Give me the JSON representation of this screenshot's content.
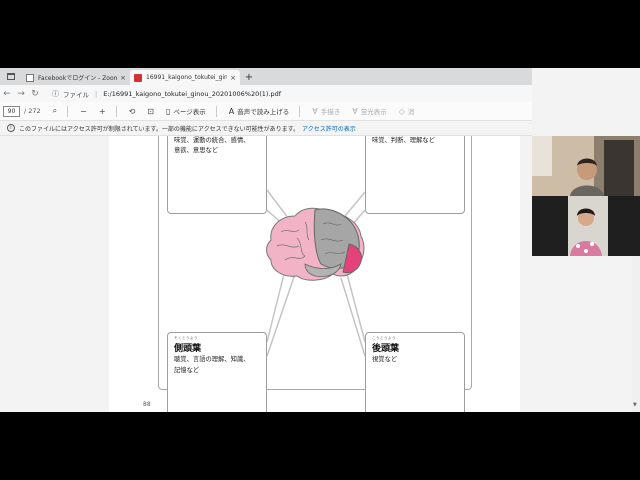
{
  "browser": {
    "tabs": [
      {
        "label": "Facebookでログイン - Zoom",
        "active": false
      },
      {
        "label": "16991_kaigono_tokutei_ginou_2...",
        "active": true
      }
    ],
    "new_tab": "+",
    "close_glyph": "×",
    "address": {
      "label": "ファイル",
      "url": "E:/16991_kaigono_tokutei_ginou_20201006%20(1).pdf"
    }
  },
  "pdf_toolbar": {
    "page_current": "90",
    "page_total": "/ 272",
    "zoom_out": "−",
    "zoom_in": "+",
    "page_view": "ページ表示",
    "read_aloud": "音声で読み上げる",
    "draw": "手描き",
    "highlight": "蛍光表示",
    "erase": "消"
  },
  "info_bar": {
    "message": "このファイルにはアクセス許可が制限されています。一部の機能にアクセスできない可能性があります。",
    "link": "アクセス許可の表示"
  },
  "document": {
    "page_number": "88",
    "panels": {
      "top_left": {
        "lines": [
          "味覚、運動の統合、感情、",
          "意欲、意思など"
        ]
      },
      "top_right": {
        "lines": [
          "味覚、判断、理解など"
        ]
      },
      "bottom_left": {
        "ruby": "そくとうよう",
        "title": "側頭葉",
        "lines": [
          "聴覚、言語の理解、知識、",
          "記憶など"
        ]
      },
      "bottom_right": {
        "ruby": "こうとうよう",
        "title": "後頭葉",
        "lines": [
          "視覚など"
        ]
      }
    }
  },
  "colors": {
    "brain_pink": "#f2b3c6",
    "brain_gray": "#a6a6a6",
    "brain_accent": "#e5417a"
  }
}
